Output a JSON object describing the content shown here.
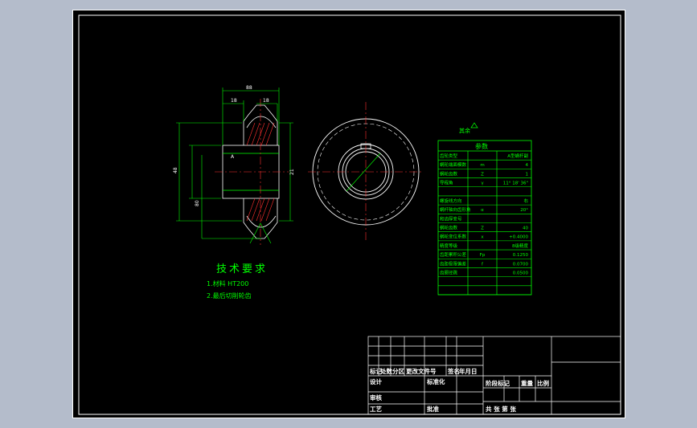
{
  "drawing": {
    "accent": "#00ff00",
    "line_color": "#ffffff",
    "background": "#000000",
    "roughness_note": "其余",
    "tech_requirements": {
      "title": "技术要求",
      "items": [
        "1.材料    HT200",
        "2.最后切削轮齿"
      ]
    },
    "section_view": {
      "label_a": "A",
      "dims": [
        "88",
        "18",
        "18",
        "48",
        "80",
        "21"
      ]
    },
    "param_table": {
      "title": "参数",
      "rows": [
        {
          "name": "齿轮类型",
          "sym": "",
          "val": "A型蜗杆副"
        },
        {
          "name": "蜗轮端面模数",
          "sym": "m",
          "val": "4"
        },
        {
          "name": "蜗轮齿数",
          "sym": "Z",
          "val": "1"
        },
        {
          "name": "导程角",
          "sym": "γ",
          "val": "11° 18' 36\""
        },
        {
          "name": "",
          "sym": "",
          "val": ""
        },
        {
          "name": "螺旋线方向",
          "sym": "",
          "val": "右"
        },
        {
          "name": "蜗杆轴向齿形角",
          "sym": "α",
          "val": "20°"
        },
        {
          "name": "和齿厚变号",
          "sym": "",
          "val": ""
        },
        {
          "name": "蜗轮齿数",
          "sym": "Z",
          "val": "40"
        },
        {
          "name": "蜗轮变位系数",
          "sym": "x",
          "val": "+0.4000"
        },
        {
          "name": "精度等级",
          "sym": "",
          "val": "8级精度"
        },
        {
          "name": "齿距累积公差",
          "sym": "Fp",
          "val": "0.1250"
        },
        {
          "name": "齿距极限偏差",
          "sym": "f",
          "val": "0.0700"
        },
        {
          "name": "齿圈径跳",
          "sym": "",
          "val": "0.0500"
        },
        {
          "name": "",
          "sym": "",
          "val": ""
        },
        {
          "name": "",
          "sym": "",
          "val": ""
        }
      ]
    },
    "title_block": {
      "change_row": [
        "标记",
        "处数",
        "分区",
        "更改文件号",
        "签名",
        "年月日"
      ],
      "design_label": "设计",
      "standard_label": "标准化",
      "stage_labels": [
        "阶段标记",
        "重量",
        "比例"
      ],
      "review_label": "审核",
      "process_label": "工艺",
      "approve_label": "批准",
      "sheet_text": "共  张 第  张"
    }
  }
}
